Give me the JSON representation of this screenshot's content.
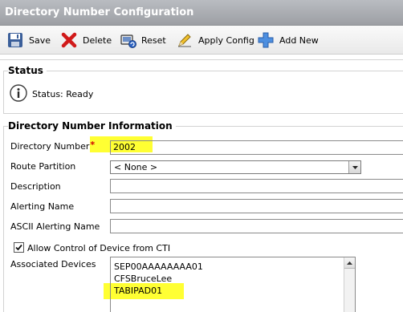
{
  "header": {
    "title": "Directory Number Configuration"
  },
  "toolbar": {
    "save_label": "Save",
    "delete_label": "Delete",
    "reset_label": "Reset",
    "apply_label": "Apply Config",
    "add_label": "Add New",
    "icons": [
      "save-icon",
      "delete-icon",
      "reset-icon",
      "apply-config-icon",
      "add-new-icon"
    ]
  },
  "status": {
    "legend": "Status",
    "text": "Status: Ready",
    "icon": "info-icon"
  },
  "dn_info": {
    "legend": "Directory Number Information",
    "directory_number_label": "Directory Number",
    "required_marker": "*",
    "directory_number_value": "2002",
    "route_partition_label": "Route Partition",
    "route_partition_value": "< None >",
    "description_label": "Description",
    "description_value": "",
    "alerting_name_label": "Alerting Name",
    "alerting_name_value": "",
    "ascii_alerting_name_label": "ASCII Alerting Name",
    "ascii_alerting_name_value": "",
    "allow_cti_label": "Allow Control of Device from CTI",
    "allow_cti_checked": true,
    "associated_devices_label": "Associated Devices",
    "associated_devices": [
      "SEP00AAAAAAAA01",
      "CFSBruceLee",
      "TABIPAD01"
    ]
  },
  "colors": {
    "highlight": "#ffff33",
    "titlebar": "#a9acb1",
    "required": "#d00000"
  }
}
